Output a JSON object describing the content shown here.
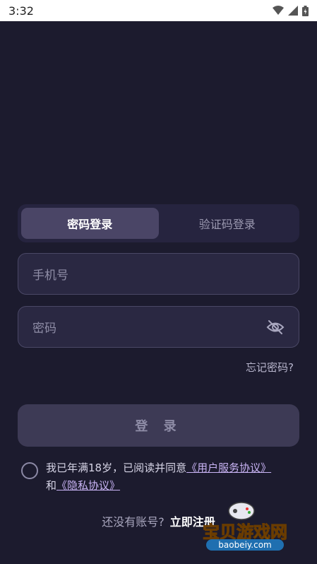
{
  "status_bar": {
    "time": "3:32"
  },
  "tabs": [
    {
      "label": "密码登录",
      "active": true
    },
    {
      "label": "验证码登录",
      "active": false
    }
  ],
  "phone_field": {
    "placeholder": "手机号"
  },
  "password_field": {
    "placeholder": "密码",
    "visibility_icon": "eye-off-icon"
  },
  "forgot_password": "忘记密码?",
  "login_button": "登 录",
  "agreement": {
    "prefix": "我已年满18岁，已阅读并同意",
    "service_link": "《用户服务协议》",
    "connector": "和",
    "privacy_link": "《隐私协议》"
  },
  "register": {
    "prompt": "还没有账号?",
    "link": "立即注册"
  },
  "watermark": {
    "title": "宝贝游戏网",
    "url": "baobeiy.com"
  },
  "colors": {
    "background": "#1c1b2e",
    "accent_link": "#c9b4f5",
    "tab_active": "#4a4566"
  }
}
